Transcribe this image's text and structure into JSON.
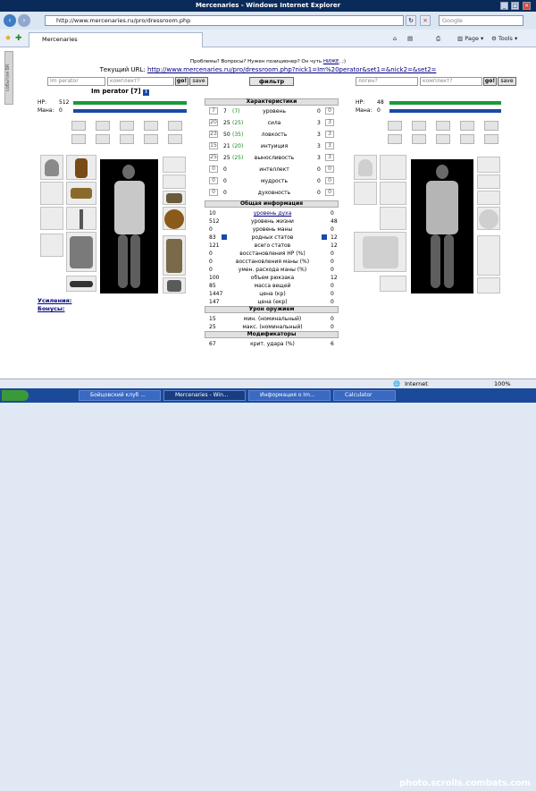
{
  "window": {
    "title": "Mercenaries - Windows Internet Explorer"
  },
  "addressbar": {
    "url": "http://www.mercenaries.ru/pro/dressroom.php",
    "search_placeholder": "Google"
  },
  "tabs": [
    {
      "label": "Mercenaries"
    }
  ],
  "toolbar": {
    "page_label": "Page",
    "tools_label": "Tools"
  },
  "sidebar": {
    "tab_label": "события БК"
  },
  "page": {
    "problems_line_prefix": "Проблемы? Вопросы? Нужен позиционер? Он чуть ",
    "problems_link": "НИЖЕ",
    ". ;)": "",
    "problems_suffix": ". ;)",
    "url_prefix": "Текущий URL: ",
    "current_url": "http://www.mercenaries.ru/pro/dressroom.php?nick1=Im%20perator&set1=&nick2=&set2=",
    "left_login": "Im perator",
    "left_set_placeholder": "комплект?",
    "go_label": "go!",
    "save_label": "save",
    "filter_label": "фильтр",
    "right_login_placeholder": "логин?",
    "right_set_placeholder": "комплект?",
    "left_char": {
      "name": "Im perator",
      "level": "[7]",
      "hp_label": "HP:",
      "hp_value": "512",
      "mana_label": "Мана:",
      "mana_value": "0"
    },
    "right_char": {
      "hp_label": "HP:",
      "hp_value": "48",
      "mana_label": "Мана:",
      "mana_value": "0"
    },
    "links": {
      "boosts": "Усиления:",
      "bonuses": "Бонусы:"
    }
  },
  "stats": {
    "header_char": "Характеристики",
    "rows": [
      {
        "base": "7",
        "val": "7",
        "bonus": "(7)",
        "label": "уровень",
        "r1": "0",
        "r2": "0"
      },
      {
        "base": "20",
        "val": "25",
        "bonus": "(25)",
        "label": "сила",
        "r1": "3",
        "r2": "3"
      },
      {
        "base": "23",
        "val": "50",
        "bonus": "(35)",
        "label": "ловкость",
        "r1": "3",
        "r2": "3"
      },
      {
        "base": "15",
        "val": "21",
        "bonus": "(20)",
        "label": "интуиция",
        "r1": "3",
        "r2": "3"
      },
      {
        "base": "25",
        "val": "25",
        "bonus": "(25)",
        "label": "выносливость",
        "r1": "3",
        "r2": "3"
      },
      {
        "base": "0",
        "val": "0",
        "bonus": "",
        "label": "интеллект",
        "r1": "0",
        "r2": "0"
      },
      {
        "base": "0",
        "val": "0",
        "bonus": "",
        "label": "мудрость",
        "r1": "0",
        "r2": "0"
      },
      {
        "base": "0",
        "val": "0",
        "bonus": "",
        "label": "духовность",
        "r1": "0",
        "r2": "0"
      }
    ],
    "header_info": "Общая информация",
    "info": [
      {
        "l": "10",
        "label": "уровень духа",
        "r": "0",
        "link": true
      },
      {
        "l": "512",
        "label": "уровень жизни",
        "r": "48"
      },
      {
        "l": "0",
        "label": "уровень маны",
        "r": "0"
      },
      {
        "l": "83",
        "label": "родных статов",
        "r": "12",
        "icon": true
      },
      {
        "l": "121",
        "label": "всего статов",
        "r": "12"
      },
      {
        "l": "0",
        "label": "восстановления HP (%)",
        "r": "0"
      },
      {
        "l": "0",
        "label": "восстановления маны (%)",
        "r": "0"
      },
      {
        "l": "0",
        "label": "умен. расхода маны (%)",
        "r": "0"
      },
      {
        "l": "100",
        "label": "объем рюкзака",
        "r": "12"
      },
      {
        "l": "85",
        "label": "масса вещей",
        "r": "0"
      },
      {
        "l": "1447",
        "label": "цена (кр)",
        "r": "0"
      },
      {
        "l": "147",
        "label": "цена (екр)",
        "r": "0"
      }
    ],
    "header_dmg": "Урон оружием",
    "dmg": [
      {
        "l": "15",
        "label": "мин. (номинальный)",
        "r": "0"
      },
      {
        "l": "25",
        "label": "макс. (номинальный)",
        "r": "0"
      }
    ],
    "header_mod": "Модификаторы",
    "mod": [
      {
        "l": "67",
        "label": "крит. удара (%)",
        "r": "6"
      }
    ]
  },
  "statusbar": {
    "zone": "Internet",
    "zoom": "100%"
  },
  "taskbar": [
    {
      "label": "Бойцовский клуб ..."
    },
    {
      "label": "Mercenaries - Win..."
    },
    {
      "label": "Информация о Im..."
    },
    {
      "label": "Calculator"
    }
  ],
  "watermark": "photo.scrolls.combats.com",
  "colors": {
    "hp": "#1a9a3a",
    "mana": "#1a4aa8",
    "titlebar": "#0a2a5a",
    "link": "#000080"
  }
}
